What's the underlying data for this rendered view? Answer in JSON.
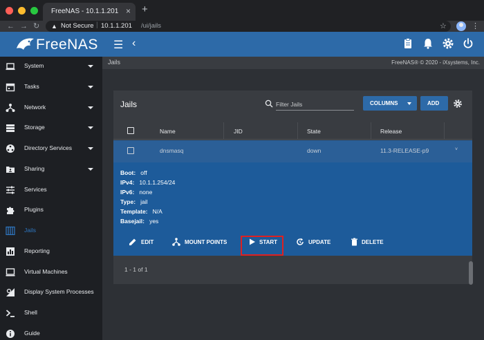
{
  "browser": {
    "tab_title": "FreeNAS - 10.1.1.201",
    "tab_close": "×",
    "new_tab": "+",
    "security_label": "Not Secure",
    "url_separator": "|",
    "url_host": "10.1.1.201",
    "url_path": "/ui/jails"
  },
  "header": {
    "logo_text": "FreeNAS",
    "icons": [
      "menu-icon",
      "back-icon",
      "clipboard-icon",
      "bell-icon",
      "gear-icon",
      "power-icon"
    ]
  },
  "sidebar": {
    "items": [
      {
        "label": "System",
        "icon": "laptop-icon",
        "has_caret": true
      },
      {
        "label": "Tasks",
        "icon": "calendar-icon",
        "has_caret": true
      },
      {
        "label": "Network",
        "icon": "network-icon",
        "has_caret": true
      },
      {
        "label": "Storage",
        "icon": "storage-icon",
        "has_caret": true
      },
      {
        "label": "Directory Services",
        "icon": "directory-icon",
        "has_caret": true
      },
      {
        "label": "Sharing",
        "icon": "folder-share-icon",
        "has_caret": true
      },
      {
        "label": "Services",
        "icon": "sliders-icon",
        "has_caret": false
      },
      {
        "label": "Plugins",
        "icon": "puzzle-icon",
        "has_caret": false
      },
      {
        "label": "Jails",
        "icon": "jail-icon",
        "has_caret": false,
        "active": true
      },
      {
        "label": "Reporting",
        "icon": "chart-icon",
        "has_caret": false
      },
      {
        "label": "Virtual Machines",
        "icon": "monitor-icon",
        "has_caret": false
      },
      {
        "label": "Display System Processes",
        "icon": "processes-icon",
        "has_caret": false
      },
      {
        "label": "Shell",
        "icon": "terminal-icon",
        "has_caret": false
      },
      {
        "label": "Guide",
        "icon": "info-icon",
        "has_caret": false
      }
    ]
  },
  "breadcrumb": "Jails",
  "copyright": "FreeNAS® © 2020 - iXsystems, Inc.",
  "card": {
    "title": "Jails",
    "search_placeholder": "Filter Jails",
    "columns_button": "COLUMNS",
    "add_button": "ADD"
  },
  "table": {
    "headers": [
      "Name",
      "JID",
      "State",
      "Release"
    ],
    "rows": [
      {
        "name": "dnsmasq",
        "jid": "",
        "state": "down",
        "release": "11.3-RELEASE-p9",
        "expand_icon": "˅"
      }
    ]
  },
  "details": [
    {
      "key": "Boot:",
      "value": "off"
    },
    {
      "key": "IPv4:",
      "value": "10.1.1.254/24"
    },
    {
      "key": "IPv6:",
      "value": "none"
    },
    {
      "key": "Type:",
      "value": "jail"
    },
    {
      "key": "Template:",
      "value": "N/A"
    },
    {
      "key": "Basejail:",
      "value": "yes"
    }
  ],
  "actions": [
    {
      "label": "EDIT",
      "icon": "pencil-icon"
    },
    {
      "label": "MOUNT POINTS",
      "icon": "mount-points-icon"
    },
    {
      "label": "START",
      "icon": "play-icon",
      "highlighted": true
    },
    {
      "label": "UPDATE",
      "icon": "update-icon"
    },
    {
      "label": "DELETE",
      "icon": "trash-icon"
    }
  ],
  "pager": "1 - 1 of 1",
  "colors": {
    "header_blue": "#2d6aa8",
    "sidebar_bg": "#1d1f23",
    "row_selected": "#2b5f97",
    "highlight_red": "#e02020",
    "active_nav": "#2f78c4"
  }
}
